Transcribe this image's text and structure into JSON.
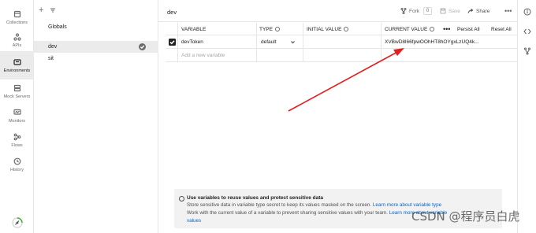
{
  "rail": {
    "items": [
      {
        "label": "Collections",
        "icon": "collections-icon"
      },
      {
        "label": "APIs",
        "icon": "apis-icon"
      },
      {
        "label": "Environments",
        "icon": "environments-icon",
        "active": true
      },
      {
        "label": "Mock Servers",
        "icon": "mock-servers-icon"
      },
      {
        "label": "Monitors",
        "icon": "monitors-icon"
      },
      {
        "label": "Flows",
        "icon": "flows-icon"
      },
      {
        "label": "History",
        "icon": "history-icon"
      }
    ]
  },
  "envlist": {
    "globals": "Globals",
    "environments": [
      "dev",
      "sit"
    ]
  },
  "header": {
    "title": "dev",
    "fork": "Fork",
    "fork_count": "0",
    "save": "Save",
    "share": "Share",
    "more": "•••"
  },
  "table": {
    "columns": [
      "VARIABLE",
      "TYPE",
      "INITIAL VALUE",
      "CURRENT VALUE"
    ],
    "more": "•••",
    "persist_all": "Persist All",
    "reset_all": "Reset All",
    "rows": [
      {
        "variable": "devToken",
        "type": "default",
        "initial": "",
        "current": "XVBwD8l66fpwOOhHT8hOYgxLzUQ4k..."
      }
    ],
    "new_placeholder": "Add a new variable"
  },
  "banner": {
    "title": "Use variables to reuse values and protect sensitive data",
    "line1_text": "Store sensitive data in variable type secret to keep its values masked on the screen.",
    "line1_link": "Learn more about variable type",
    "line2_text": "Work with the current value of a variable to prevent sharing sensitive values with your team.",
    "line2_link": "Learn more about variable",
    "line3_link": "values"
  },
  "watermark": "CSDN @程序员白虎",
  "colors": {
    "arrow": "#e02020",
    "link": "#0265d2",
    "accent": "#212121"
  }
}
